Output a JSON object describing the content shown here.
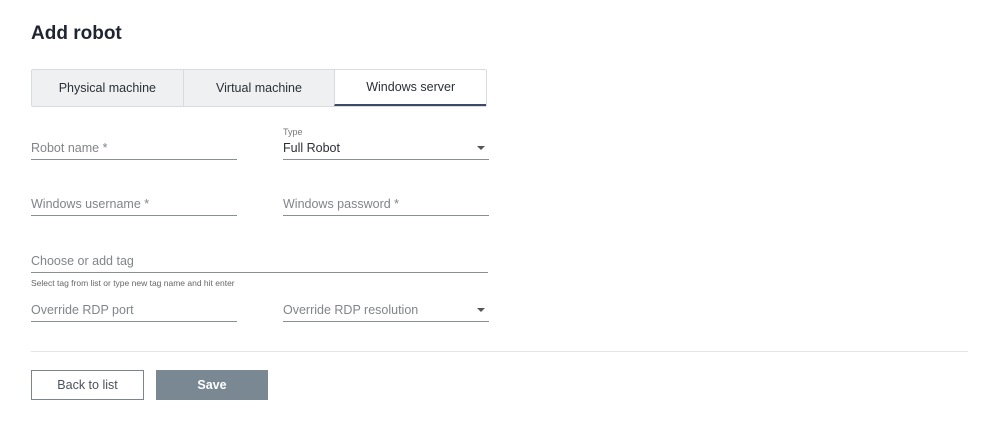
{
  "page": {
    "title": "Add robot"
  },
  "tabs": [
    {
      "label": "Physical machine",
      "active": false
    },
    {
      "label": "Virtual machine",
      "active": false
    },
    {
      "label": "Windows server",
      "active": true
    }
  ],
  "form": {
    "robot_name": {
      "placeholder": "Robot name *"
    },
    "type": {
      "label": "Type",
      "value": "Full Robot"
    },
    "windows_username": {
      "placeholder": "Windows username *"
    },
    "windows_password": {
      "placeholder": "Windows password *"
    },
    "tag": {
      "placeholder": "Choose or add tag",
      "hint": "Select tag from list or type new tag name and hit enter"
    },
    "rdp_port": {
      "placeholder": "Override RDP port"
    },
    "rdp_resolution": {
      "placeholder": "Override RDP resolution"
    }
  },
  "actions": {
    "back_label": "Back to list",
    "save_label": "Save"
  },
  "colors": {
    "active_tab_underline": "#3b4a66",
    "save_button": "#7a8894"
  }
}
